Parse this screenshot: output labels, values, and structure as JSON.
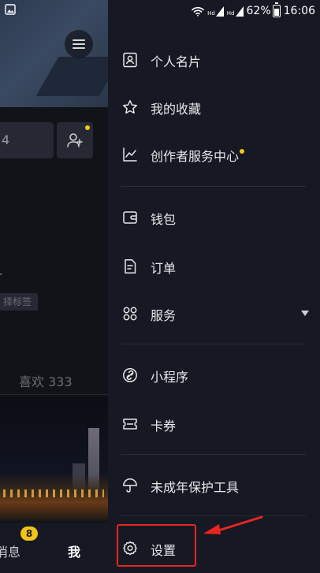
{
  "status_bar": {
    "signal_labels": [
      "Hd",
      "Hd"
    ],
    "battery_pct": "62%",
    "time": "16:06"
  },
  "background_page": {
    "edit_fragment": "4",
    "bio_fragment": "-",
    "tag_fragment": "择标签",
    "like_tab": "喜欢 333",
    "bottom_nav": {
      "messages_label": "消息",
      "messages_badge": "8",
      "me_label": "我"
    }
  },
  "drawer": {
    "groups": [
      {
        "items": [
          {
            "id": "business-card",
            "label": "个人名片",
            "icon": "id-card-icon"
          },
          {
            "id": "favorites",
            "label": "我的收藏",
            "icon": "star-icon"
          },
          {
            "id": "creator-center",
            "label": "创作者服务中心",
            "icon": "trend-chart-icon",
            "has_dot": true
          }
        ]
      },
      {
        "items": [
          {
            "id": "wallet",
            "label": "钱包",
            "icon": "wallet-icon"
          },
          {
            "id": "orders",
            "label": "订单",
            "icon": "order-doc-icon"
          },
          {
            "id": "services",
            "label": "服务",
            "icon": "grid-flower-icon",
            "expandable": true
          }
        ]
      },
      {
        "items": [
          {
            "id": "mini-programs",
            "label": "小程序",
            "icon": "link-icon"
          },
          {
            "id": "coupons",
            "label": "卡券",
            "icon": "ticket-icon"
          }
        ]
      },
      {
        "items": [
          {
            "id": "minor-protection",
            "label": "未成年保护工具",
            "icon": "umbrella-icon"
          }
        ]
      },
      {
        "items": [
          {
            "id": "settings",
            "label": "设置",
            "icon": "gear-icon"
          }
        ]
      }
    ]
  },
  "colors": {
    "background": "#161823",
    "accent_dot": "#f5c518",
    "annotation": "#e8261f",
    "badge": "#f0c31a"
  }
}
